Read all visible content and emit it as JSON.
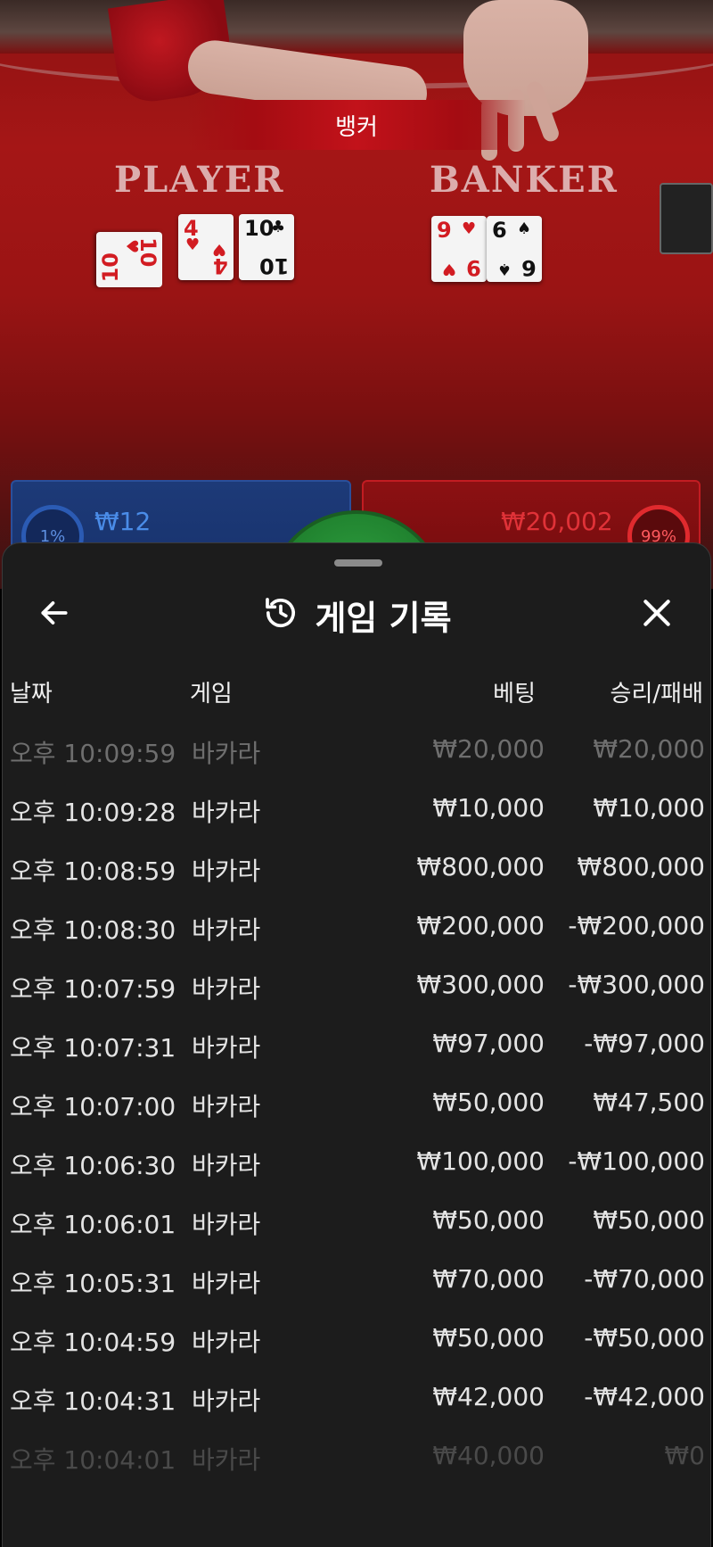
{
  "table": {
    "result_banner": "뱅커",
    "player_label": "PLAYER",
    "banker_label": "BANKER",
    "player_cards": [
      {
        "rank": "10",
        "suit": "♥",
        "color": "red"
      },
      {
        "rank": "4",
        "suit": "♥",
        "color": "red"
      },
      {
        "rank": "10",
        "suit": "♣",
        "color": "black"
      }
    ],
    "banker_cards": [
      {
        "rank": "9",
        "suit": "♥",
        "color": "red"
      },
      {
        "rank": "6",
        "suit": "♠",
        "color": "black"
      }
    ],
    "player_bet": {
      "percent": "1%",
      "amount": "₩12"
    },
    "banker_bet": {
      "percent": "99%",
      "amount": "₩20,002"
    }
  },
  "sheet": {
    "title": "게임 기록",
    "icons": {
      "back": "arrow-left-icon",
      "history": "history-icon",
      "close": "close-icon"
    },
    "columns": {
      "date": "날짜",
      "game": "게임",
      "bet": "베팅",
      "result": "승리/패배"
    },
    "rows": [
      {
        "time": "오후 10:09:59",
        "game": "바카라",
        "bet": "₩20,000",
        "result": "₩20,000"
      },
      {
        "time": "오후 10:09:28",
        "game": "바카라",
        "bet": "₩10,000",
        "result": "₩10,000"
      },
      {
        "time": "오후 10:08:59",
        "game": "바카라",
        "bet": "₩800,000",
        "result": "₩800,000"
      },
      {
        "time": "오후 10:08:30",
        "game": "바카라",
        "bet": "₩200,000",
        "result": "-₩200,000"
      },
      {
        "time": "오후 10:07:59",
        "game": "바카라",
        "bet": "₩300,000",
        "result": "-₩300,000"
      },
      {
        "time": "오후 10:07:31",
        "game": "바카라",
        "bet": "₩97,000",
        "result": "-₩97,000"
      },
      {
        "time": "오후 10:07:00",
        "game": "바카라",
        "bet": "₩50,000",
        "result": "₩47,500"
      },
      {
        "time": "오후 10:06:30",
        "game": "바카라",
        "bet": "₩100,000",
        "result": "-₩100,000"
      },
      {
        "time": "오후 10:06:01",
        "game": "바카라",
        "bet": "₩50,000",
        "result": "₩50,000"
      },
      {
        "time": "오후 10:05:31",
        "game": "바카라",
        "bet": "₩70,000",
        "result": "-₩70,000"
      },
      {
        "time": "오후 10:04:59",
        "game": "바카라",
        "bet": "₩50,000",
        "result": "-₩50,000"
      },
      {
        "time": "오후 10:04:31",
        "game": "바카라",
        "bet": "₩42,000",
        "result": "-₩42,000"
      },
      {
        "time": "오후 10:04:01",
        "game": "바카라",
        "bet": "₩40,000",
        "result": "₩0"
      }
    ]
  },
  "colors": {
    "sheet_bg": "#1c1c1c",
    "player_blue": "#1d3a78",
    "banker_red": "#c21c22"
  }
}
